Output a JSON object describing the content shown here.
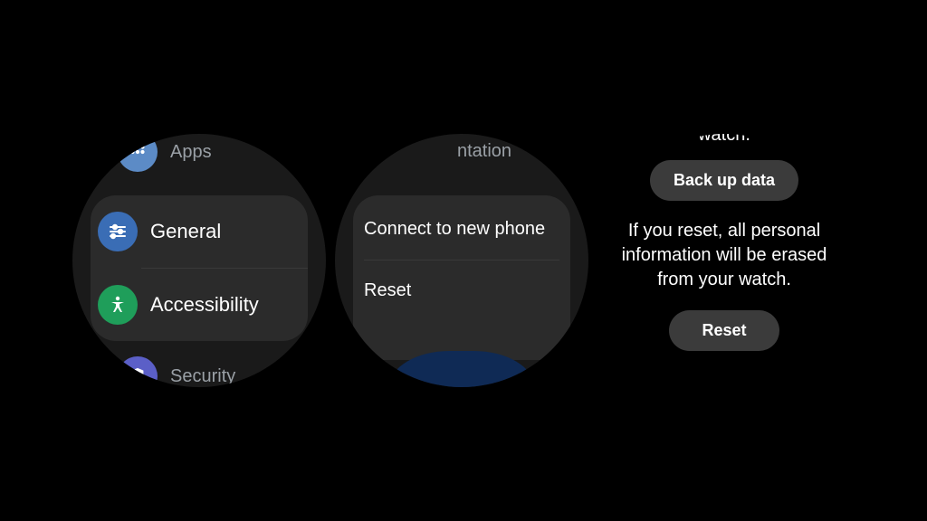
{
  "watch1": {
    "apps": "Apps",
    "general": "General",
    "accessibility": "Accessibility",
    "security": "Security"
  },
  "watch2": {
    "top_partial": "ntation",
    "connect": "Connect to new phone",
    "reset": "Reset"
  },
  "watch3": {
    "top_partial": "watch.",
    "backup": "Back up data",
    "warning": "If you reset, all personal information will be erased from your watch.",
    "reset": "Reset"
  }
}
